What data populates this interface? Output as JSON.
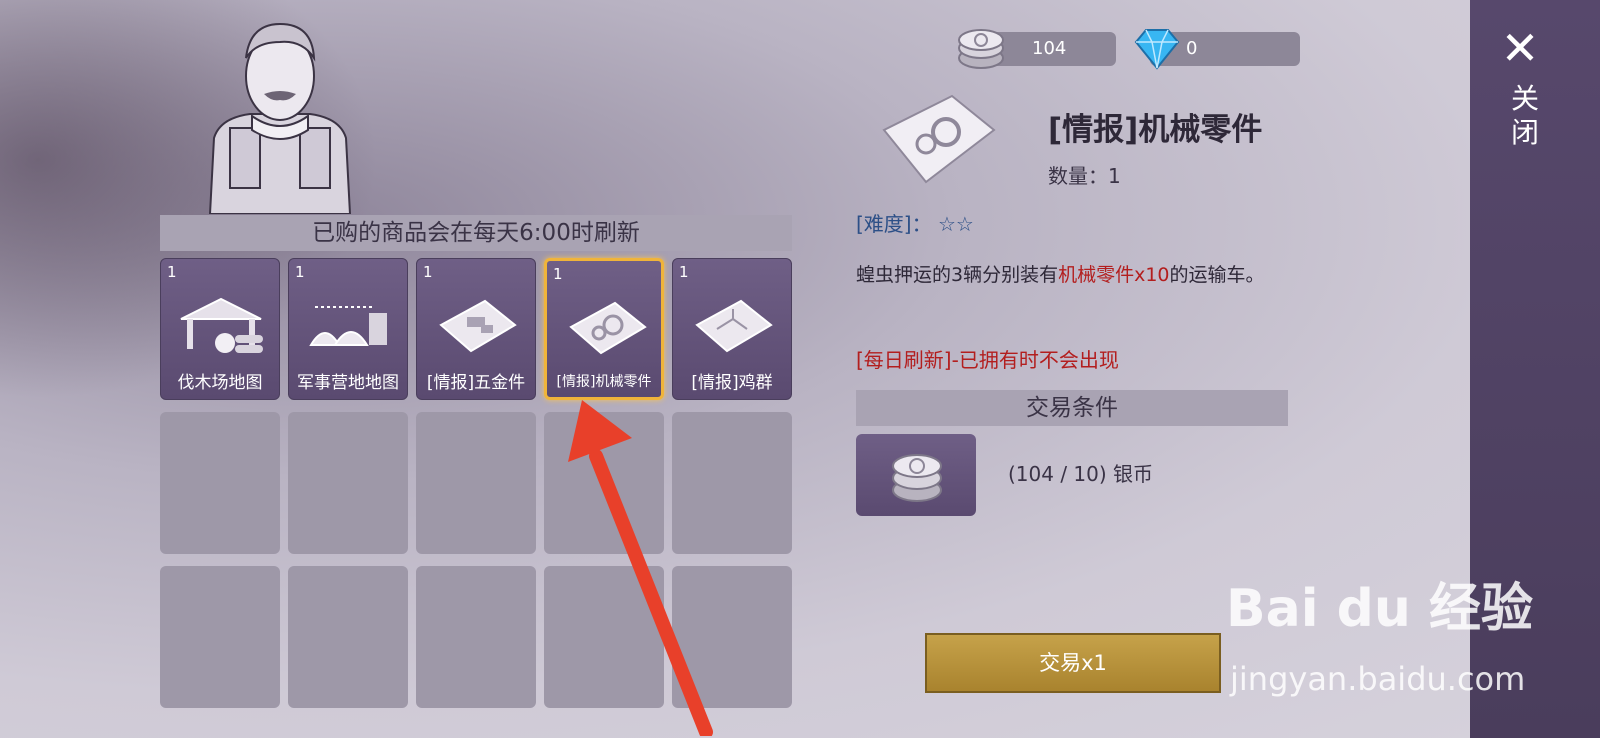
{
  "shop": {
    "refresh_notice": "已购的商品会在每天6:00时刷新",
    "items": [
      {
        "qty": "1",
        "name": "伐木场地图",
        "icon": "sawmill-map-icon"
      },
      {
        "qty": "1",
        "name": "军事营地地图",
        "icon": "military-camp-map-icon"
      },
      {
        "qty": "1",
        "name": "[情报]五金件",
        "icon": "intel-hardware-icon"
      },
      {
        "qty": "1",
        "name": "[情报]机械零件",
        "icon": "intel-mechanical-parts-icon"
      },
      {
        "qty": "1",
        "name": "[情报]鸡群",
        "icon": "intel-chickens-icon"
      }
    ]
  },
  "currency": {
    "silver": "104",
    "diamond": "0"
  },
  "detail": {
    "title": "[情报]机械零件",
    "count": "数量：1",
    "difficulty_label": "[难度]：",
    "difficulty_stars": "☆☆",
    "desc_pre": "蝗虫押运的3辆分别装有",
    "desc_red": "机械零件x10",
    "desc_post": "的运输车。",
    "daily_note": "[每日刷新]-已拥有时不会出现",
    "trade_header": "交易条件",
    "cost_text": "(104 / 10) 银币",
    "trade_button": "交易x1"
  },
  "close": {
    "label": "关闭"
  },
  "watermark": {
    "brand": "Bai du 经验",
    "url": "jingyan.baidu.com"
  },
  "colors": {
    "slot_fill": "#6f5f86",
    "selected_border": "#f0b43a",
    "trade_button": "#c6a24a",
    "alert_red": "#b31e1e",
    "arrow_red": "#e8402a"
  }
}
